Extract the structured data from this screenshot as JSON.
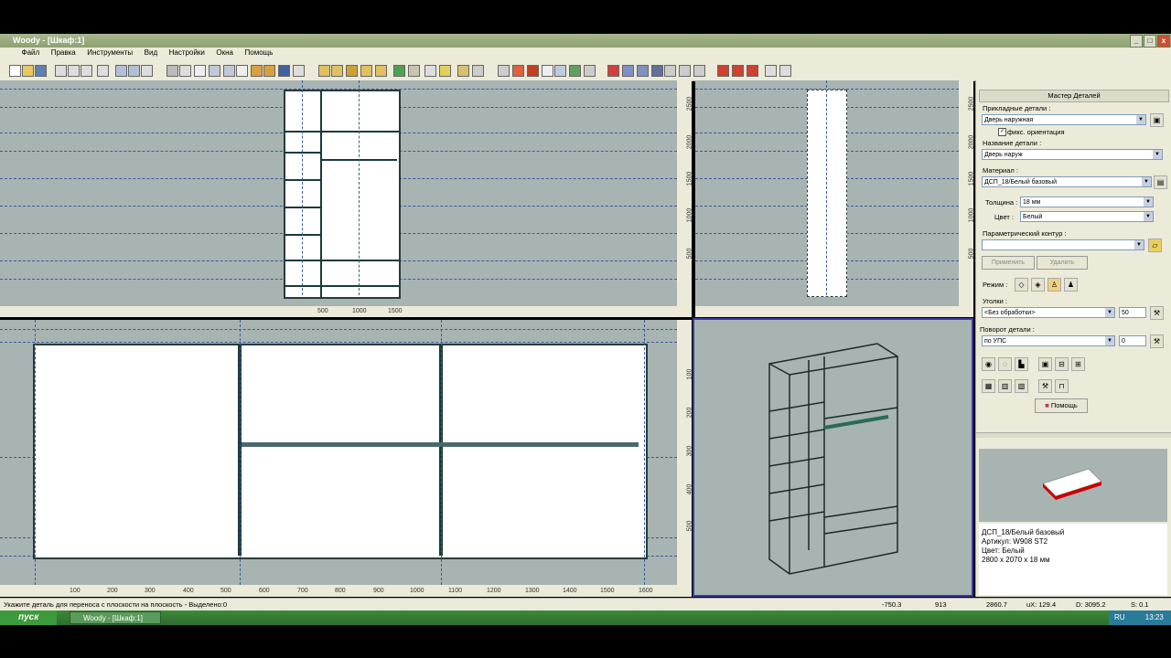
{
  "window": {
    "title": "Woody - [Шкаф:1]"
  },
  "menu": [
    "Файл",
    "Правка",
    "Инструменты",
    "Вид",
    "Настройки",
    "Окна",
    "Помощь"
  ],
  "views": {
    "front_ruler_right": [
      "2500",
      "2000",
      "1500",
      "1000",
      "500"
    ],
    "front_ruler_bottom": [
      "500",
      "1000",
      "1500"
    ],
    "side_ruler_right": [
      "2500",
      "2000",
      "1500",
      "1000",
      "500"
    ],
    "top_ruler_right": [
      "100",
      "200",
      "300",
      "400",
      "500"
    ],
    "top_ruler_bottom": [
      "100",
      "200",
      "300",
      "400",
      "500",
      "600",
      "700",
      "800",
      "900",
      "1000",
      "1100",
      "1200",
      "1300",
      "1400",
      "1500",
      "1600"
    ]
  },
  "panel": {
    "header": "Мастер Деталей",
    "applied_label": "Прикладные детали :",
    "applied_value": "Дверь наружная",
    "fix_orientation": "фикс. ориентация",
    "name_label": "Название детали :",
    "name_value": "Дверь наруж",
    "material_label": "Материал :",
    "material_value": "ДСП_18/Белый базовый",
    "thickness_label": "Толщина :",
    "thickness_value": "18 мм",
    "color_label": "Цвет :",
    "color_value": "Белый",
    "contour_label": "Параметрический контур :",
    "apply_button": "Применить",
    "delete_button": "Удалить",
    "mode_label": "Режим :",
    "corners_label": "Уголки :",
    "corners_value": "<Без обработки>",
    "corners_num": "50",
    "rotation_label": "Поворот детали :",
    "rotation_value": "по УПС",
    "rotation_num": "0",
    "help_button": "Помощь",
    "info_material": "ДСП_18/Белый базовый",
    "info_article": "Артикул: W908 ST2",
    "info_color": "Цвет: Белый",
    "info_size": "2800 x 2070 x 18 мм"
  },
  "status": {
    "message": "Укажите деталь для переноса с плоскости на плоскость - Выделено:0",
    "x": "-750.3",
    "y": "913",
    "z": "2860.7",
    "ux": "uX: 129.4",
    "d": "D: 3095.2",
    "s": "S: 0.1"
  },
  "taskbar": {
    "start": "пуск",
    "task": "Woody - [Шкаф:1]",
    "lang": "RU",
    "time": "13:23"
  }
}
